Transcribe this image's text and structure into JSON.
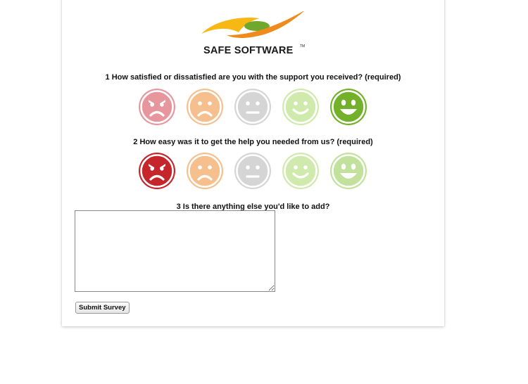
{
  "brand": {
    "name": "SAFE SOFTWARE",
    "trademark": "TM",
    "logo_icon": "safe-software-swoosh-logo",
    "colors": {
      "swoosh_yellow": "#f7b814",
      "swoosh_orange": "#ef8a1c",
      "swoosh_green": "#6ea82c"
    }
  },
  "questions": [
    {
      "label": "1 How satisfied or dissatisfied are you with the support you received? (required)",
      "options": [
        {
          "icon": "very-dissatisfied-face-icon",
          "color": "#e8969d",
          "selected": false
        },
        {
          "icon": "dissatisfied-face-icon",
          "color": "#f5c08e",
          "selected": false
        },
        {
          "icon": "neutral-face-icon",
          "color": "#d5d5d5",
          "selected": false
        },
        {
          "icon": "satisfied-face-icon",
          "color": "#d0e9ad",
          "selected": false
        },
        {
          "icon": "very-satisfied-face-icon",
          "color": "#74b12a",
          "selected": true
        }
      ]
    },
    {
      "label": "2 How easy was it to get the help you needed from us? (required)",
      "options": [
        {
          "icon": "very-difficult-face-icon",
          "color": "#c4262c",
          "selected": true
        },
        {
          "icon": "difficult-face-icon",
          "color": "#f5c08e",
          "selected": false
        },
        {
          "icon": "neutral-face-icon",
          "color": "#d5d5d5",
          "selected": false
        },
        {
          "icon": "easy-face-icon",
          "color": "#d0e9ad",
          "selected": false
        },
        {
          "icon": "very-easy-face-icon",
          "color": "#c2e19c",
          "selected": false
        }
      ]
    },
    {
      "label": "3 Is there anything else you'd like to add?",
      "value": "",
      "placeholder": ""
    }
  ],
  "submit_label": "Submit Survey"
}
